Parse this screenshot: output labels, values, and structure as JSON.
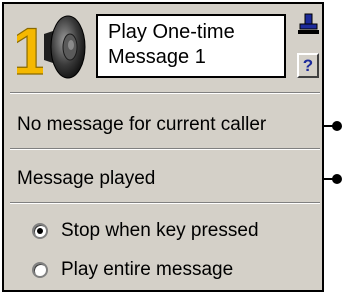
{
  "node": {
    "step_number": "1",
    "title": "Play One-time\nMessage 1",
    "icons": {
      "speaker": "speaker-icon",
      "stamp": "stamp-icon",
      "help": "help-icon"
    },
    "help_label": "?"
  },
  "outputs": [
    {
      "label": "No message for current caller"
    },
    {
      "label": "Message played"
    }
  ],
  "options": {
    "selected": "stop_when_key_pressed",
    "items": [
      {
        "id": "stop_when_key_pressed",
        "label": "Stop when key pressed",
        "checked": true
      },
      {
        "id": "play_entire_message",
        "label": "Play entire message",
        "checked": false
      }
    ]
  },
  "colors": {
    "panel": "#d4d0c8",
    "number_fill": "#f5b800",
    "help_text": "#1c2a9b",
    "stamp": "#1c2a9b"
  }
}
